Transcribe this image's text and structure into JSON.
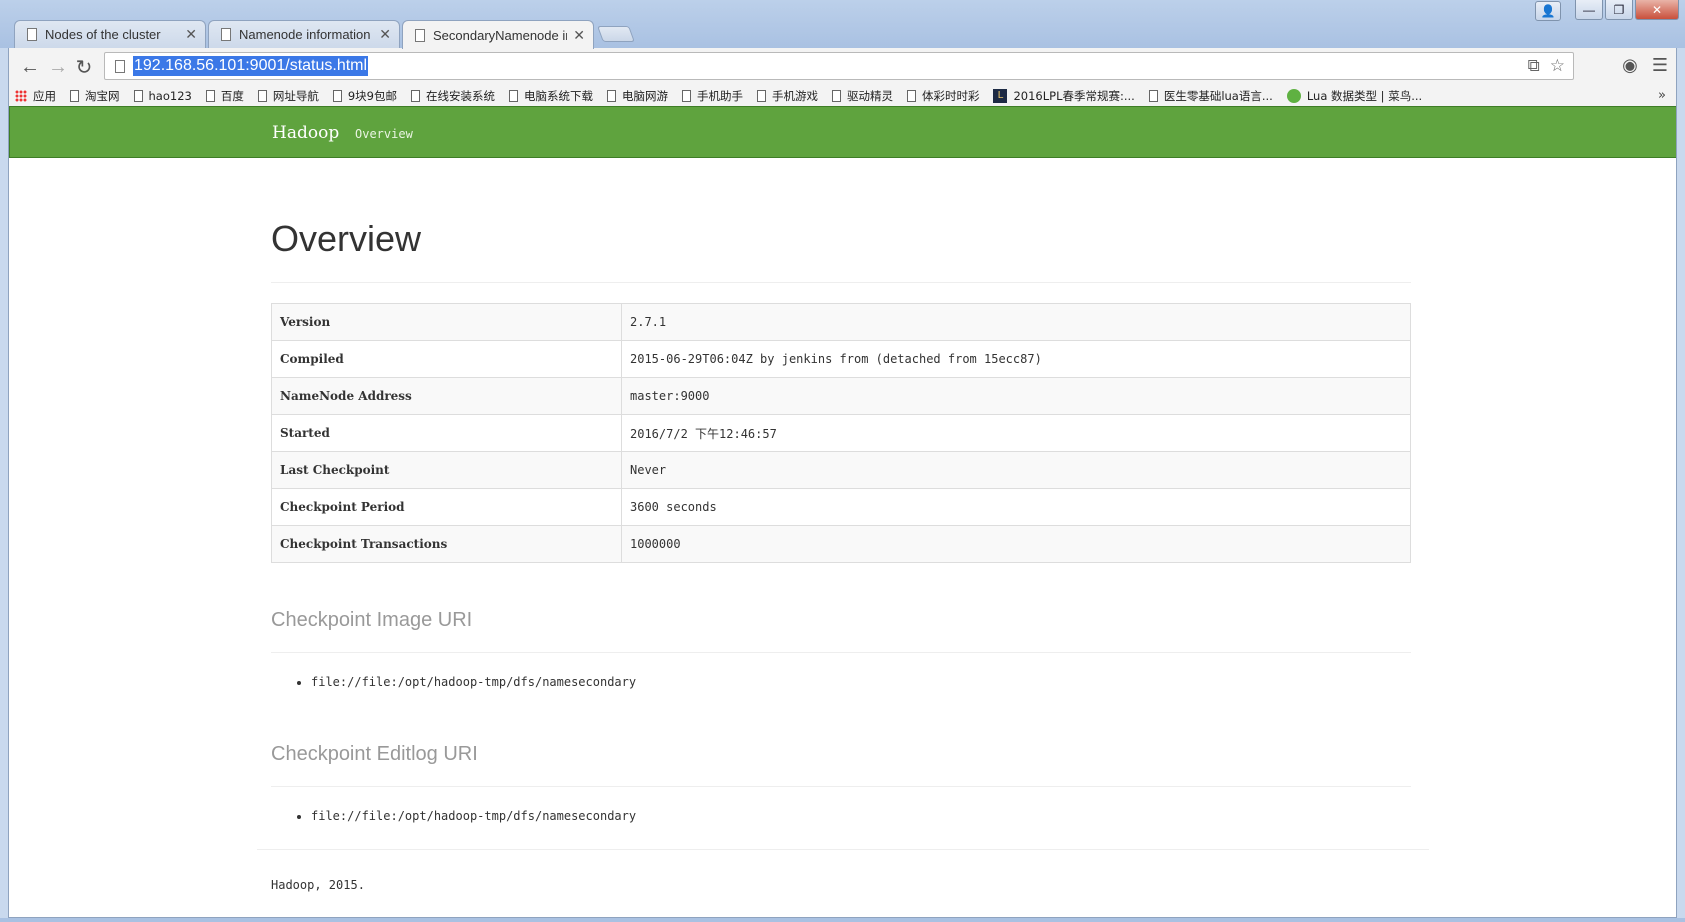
{
  "browser": {
    "tabs": [
      {
        "label": "Nodes of the cluster",
        "active": false
      },
      {
        "label": "Namenode information",
        "active": false
      },
      {
        "label": "SecondaryNamenode info",
        "active": true
      }
    ],
    "url": "192.168.56.101:9001/status.html",
    "bookmarks": [
      {
        "label": "应用",
        "icon": "apps-grid-icon"
      },
      {
        "label": "淘宝网",
        "icon": "page-icon"
      },
      {
        "label": "hao123",
        "icon": "page-icon"
      },
      {
        "label": "百度",
        "icon": "page-icon"
      },
      {
        "label": "网址导航",
        "icon": "page-icon"
      },
      {
        "label": "9块9包邮",
        "icon": "page-icon"
      },
      {
        "label": "在线安装系统",
        "icon": "page-icon"
      },
      {
        "label": "电脑系统下载",
        "icon": "page-icon"
      },
      {
        "label": "电脑网游",
        "icon": "page-icon"
      },
      {
        "label": "手机助手",
        "icon": "page-icon"
      },
      {
        "label": "手机游戏",
        "icon": "page-icon"
      },
      {
        "label": "驱动精灵",
        "icon": "page-icon"
      },
      {
        "label": "体彩时时彩",
        "icon": "page-icon"
      },
      {
        "label": "2016LPL春季常规赛:...",
        "icon": "lpl-icon"
      },
      {
        "label": "医生零基础lua语言...",
        "icon": "page-icon"
      },
      {
        "label": "Lua 数据类型 | 菜鸟...",
        "icon": "lua-icon"
      }
    ],
    "bookmarks_more": "»"
  },
  "navbar": {
    "brand": "Hadoop",
    "links": [
      "Overview"
    ],
    "color": "#5fa33e"
  },
  "page": {
    "title": "Overview",
    "info_rows": [
      {
        "key": "Version",
        "value": "2.7.1"
      },
      {
        "key": "Compiled",
        "value": "2015-06-29T06:04Z by jenkins from (detached from 15ecc87)"
      },
      {
        "key": "NameNode Address",
        "value": "master:9000"
      },
      {
        "key": "Started",
        "value": "2016/7/2 下午12:46:57"
      },
      {
        "key": "Last Checkpoint",
        "value": "Never"
      },
      {
        "key": "Checkpoint Period",
        "value": "3600 seconds"
      },
      {
        "key": "Checkpoint Transactions",
        "value": "1000000"
      }
    ],
    "image_uri_heading": "Checkpoint Image URI",
    "image_uris": [
      "file://file:/opt/hadoop-tmp/dfs/namesecondary"
    ],
    "editlog_uri_heading": "Checkpoint Editlog URI",
    "editlog_uris": [
      "file://file:/opt/hadoop-tmp/dfs/namesecondary"
    ],
    "footer": "Hadoop, 2015."
  }
}
